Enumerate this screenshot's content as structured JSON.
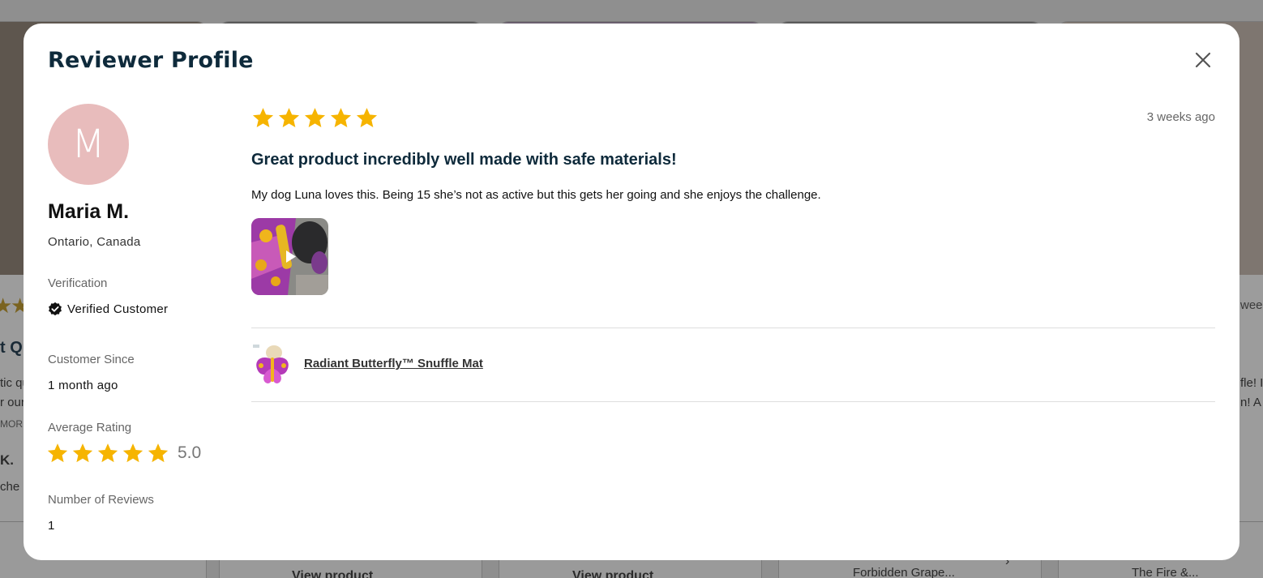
{
  "background": {
    "cards": [
      {
        "snippet_1": "t Qu",
        "snippet_2": "tic qu",
        "snippet_3": "r our",
        "snippet_4": "MORE",
        "snippet_5": "K.",
        "snippet_6": "che"
      },
      {
        "footer_text": "View product"
      },
      {
        "footer_text": "View product"
      },
      {
        "footer_text": "Forbidden Grape..."
      },
      {
        "footer_text": "The Fire &...",
        "snippet_1": "wee",
        "snippet_2": "fle! I",
        "snippet_3": "n! A"
      }
    ]
  },
  "modal": {
    "title": "Reviewer Profile",
    "close_icon": "close-icon"
  },
  "reviewer": {
    "initial": "M",
    "avatar_color": "#e8bcbc",
    "name": "Maria M.",
    "location": "Ontario, Canada",
    "verification_label": "Verification",
    "verification_value": "Verified Customer",
    "customer_since_label": "Customer Since",
    "customer_since_value": "1 month ago",
    "average_rating_label": "Average Rating",
    "average_rating_stars": 5,
    "average_rating_value": "5.0",
    "num_reviews_label": "Number of Reviews",
    "num_reviews_value": "1"
  },
  "review": {
    "rating": 5,
    "date": "3 weeks ago",
    "title": "Great product incredibly well made with safe materials!",
    "body": "My dog Luna loves this. Being 15 she’s not as active but this gets her going and she enjoys the challenge.",
    "media_icon": "play-icon",
    "product_name": "Radiant Butterfly™ Snuffle Mat"
  },
  "colors": {
    "star": "#f6b400",
    "title": "#0e2a3b",
    "muted": "#666666"
  }
}
